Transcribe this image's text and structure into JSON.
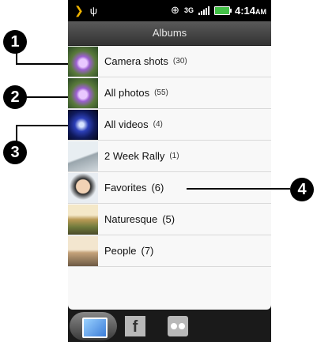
{
  "status_bar": {
    "time": "4:14",
    "ampm": "AM",
    "network": "3G"
  },
  "title": "Albums",
  "albums": [
    {
      "name": "Camera shots",
      "count": "(30)"
    },
    {
      "name": "All photos",
      "count": "(55)"
    },
    {
      "name": "All videos",
      "count": "(4)"
    },
    {
      "name": "2 Week Rally",
      "count": "(1)"
    },
    {
      "name": "Favorites",
      "count": "(6)"
    },
    {
      "name": "Naturesque",
      "count": "(5)"
    },
    {
      "name": "People",
      "count": "(7)"
    }
  ],
  "callouts": [
    "1",
    "2",
    "3",
    "4"
  ],
  "bottom_tabs": [
    {
      "icon": "gallery-icon"
    },
    {
      "icon": "facebook-icon",
      "glyph": "f"
    },
    {
      "icon": "flickr-icon"
    }
  ]
}
